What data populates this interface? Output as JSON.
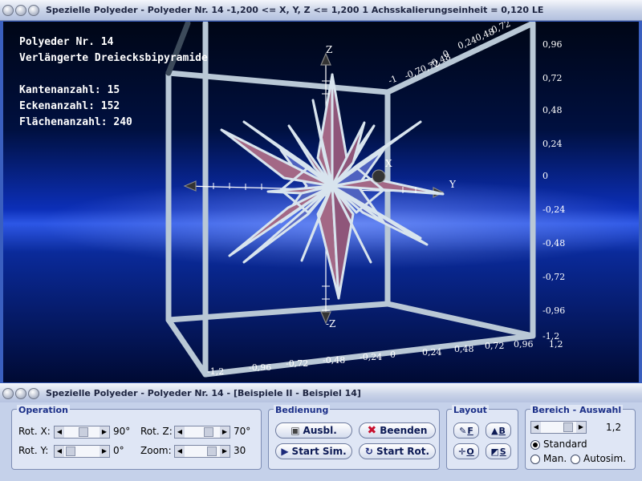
{
  "window_top": {
    "title": "Spezielle Polyeder - Polyeder Nr. 14   -1,200 <= X, Y, Z <= 1,200    1 Achsskalierungseinheit = 0,120 LE"
  },
  "info": {
    "polyeder": "Polyeder Nr. 14",
    "name": "Verlängerte Dreiecksbipyramide",
    "kanten": "Kantenanzahl: 15",
    "ecken": "Eckenanzahl: 152",
    "flaechen": "Flächenanzahl: 240"
  },
  "axes": {
    "x_label": "X",
    "y_label": "Y",
    "z_label": "Z",
    "z_neg_label": "-Z",
    "right_ticks": [
      "0,96",
      "0,72",
      "0,48",
      "0,24",
      "0",
      "-0,24",
      "-0,48",
      "-0,72",
      "-0,96",
      "-1,2",
      "1,2"
    ],
    "bottom_ticks": [
      "-1,2",
      "-0,96",
      "-0,72",
      "-0,48",
      "-0,24",
      "0",
      "0,24",
      "0,48",
      "0,72",
      "0,96"
    ],
    "top_ticks": [
      "-1",
      "-0,7",
      "-0,72",
      "-0,48",
      "0",
      "0,24",
      "0,48",
      "0,72"
    ]
  },
  "window_bottom": {
    "title": "Spezielle Polyeder - Polyeder Nr. 14 - [Beispiele II - Beispiel 14]"
  },
  "operation": {
    "title": "Operation",
    "rot_x_label": "Rot. X:",
    "rot_x_value": "90°",
    "rot_y_label": "Rot. Y:",
    "rot_y_value": "0°",
    "rot_z_label": "Rot. Z:",
    "rot_z_value": "70°",
    "zoom_label": "Zoom:",
    "zoom_value": "30"
  },
  "bedienung": {
    "title": "Bedienung",
    "ausbl": "Ausbl.",
    "beenden": "Beenden",
    "start_sim": "Start Sim.",
    "start_rot": "Start Rot."
  },
  "layout": {
    "title": "Layout",
    "btn_f": "F",
    "btn_b": "B",
    "btn_o": "O",
    "btn_s": "S"
  },
  "bereich": {
    "title": "Bereich - Auswahl",
    "value": "1,2",
    "standard": "Standard",
    "man": "Man.",
    "autosim": "Autosim.",
    "selected": "standard"
  }
}
